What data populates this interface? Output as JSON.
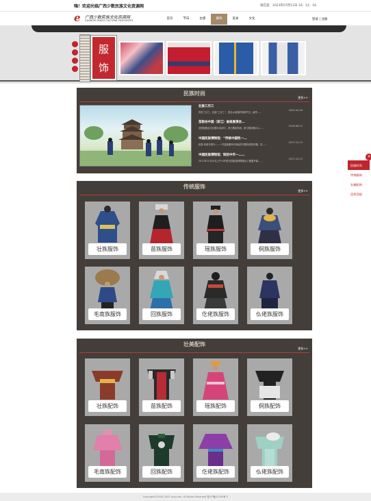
{
  "header": {
    "welcome": "嗨！欢迎光临广西少数民族文化资源网",
    "clock": "现在是：2023年07月11日 16：12：18",
    "logo_cn": "广西少数民族文化资源网",
    "logo_en": "GUANGXI MINZU CULTURAL RESOURCES",
    "login": "登录 | 注册"
  },
  "nav": [
    {
      "label": "首页"
    },
    {
      "label": "节日"
    },
    {
      "label": "古建"
    },
    {
      "label": "服饰"
    },
    {
      "label": "美食"
    },
    {
      "label": "文化"
    }
  ],
  "nav_active_index": 3,
  "banner": {
    "title_1": "服",
    "title_2": "饰"
  },
  "news": {
    "title": "民族时尚",
    "more": "更多>>",
    "items": [
      {
        "title": "壮族三月三",
        "desc": "农历三月三，壮族“三月三”，是壮乡民族的传统节日，最早……",
        "date": "2020-04-26"
      },
      {
        "title": "苗韵谷中国（浙江）省级展演会…",
        "desc": "全国苗韵谷文化展示活动中，浙江展区热闹，浙江展区展示以……",
        "date": "2018-06-12"
      },
      {
        "title": "中国民族博物馆：“传统中国性一…",
        "desc": "民族·传统与现代——一件苗族服饰中刻绘的中国传统的问题。在……",
        "date": "2017-12-13"
      },
      {
        "title": "中国民族博物馆：制后中华一……",
        "desc": "2017年11月30日上午10时在中国民族博物馆台上隆重开幕……",
        "date": "2017-12-13"
      }
    ]
  },
  "costumes": {
    "title": "传统服饰",
    "more": "更多>>",
    "items": [
      {
        "label": "壮族服饰"
      },
      {
        "label": "苗族服饰"
      },
      {
        "label": "瑶族服饰"
      },
      {
        "label": "侗族服饰"
      },
      {
        "label": "毛南族服饰"
      },
      {
        "label": "回族服饰"
      },
      {
        "label": "仡佬族服饰"
      },
      {
        "label": "仫佬族服饰"
      }
    ]
  },
  "accessories": {
    "title": "壮美配饰",
    "more": "更多>>",
    "items": [
      {
        "label": "壮族配饰"
      },
      {
        "label": "苗族配饰"
      },
      {
        "label": "瑶族配饰"
      },
      {
        "label": "侗族配饰"
      },
      {
        "label": "毛南族配饰"
      },
      {
        "label": "回族配饰"
      },
      {
        "label": "仡佬族配饰"
      },
      {
        "label": "仫佬族配饰"
      }
    ]
  },
  "side_menu": {
    "close_icon": "close-icon",
    "items": [
      {
        "label": "民族时尚"
      },
      {
        "label": "传统服饰"
      },
      {
        "label": "壮美配饰"
      },
      {
        "label": "回到顶部"
      }
    ]
  },
  "footer": "Copyright©2020-2022 zzzy.com, All Rights Reserved 桂ICP备12345号-2",
  "colors": {
    "brand_red": "#c0262d",
    "section_bg": "#433e39",
    "nav_active": "#a48a69"
  }
}
